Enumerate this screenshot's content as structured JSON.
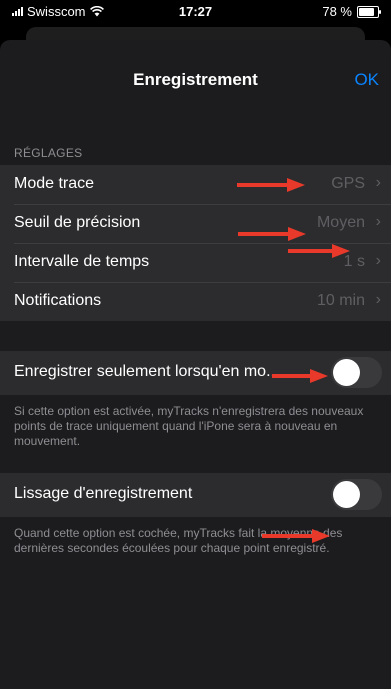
{
  "status_bar": {
    "carrier": "Swisscom",
    "time": "17:27",
    "battery": "78 %"
  },
  "nav": {
    "title": "Enregistrement",
    "ok": "OK"
  },
  "section_header": "RÉGLAGES",
  "settings": [
    {
      "label": "Mode trace",
      "value": "GPS"
    },
    {
      "label": "Seuil de précision",
      "value": "Moyen"
    },
    {
      "label": "Intervalle de temps",
      "value": "1 s"
    },
    {
      "label": "Notifications",
      "value": "10 min"
    }
  ],
  "record_when_moving": {
    "label": "Enregistrer seulement lorsqu'en mo...",
    "enabled": false,
    "footnote": "Si cette option est activée, myTracks n'enregistrera des nouveaux points de trace uniquement quand l'iPone sera à nouveau en mouvement."
  },
  "smoothing": {
    "label": "Lissage d'enregistrement",
    "enabled": false,
    "footnote": "Quand cette option est cochée, myTracks fait la moyenne des dernières secondes écoulées pour chaque point enregistré."
  },
  "colors": {
    "accent": "#0a84ff",
    "annotation_arrow": "#e8392a"
  }
}
